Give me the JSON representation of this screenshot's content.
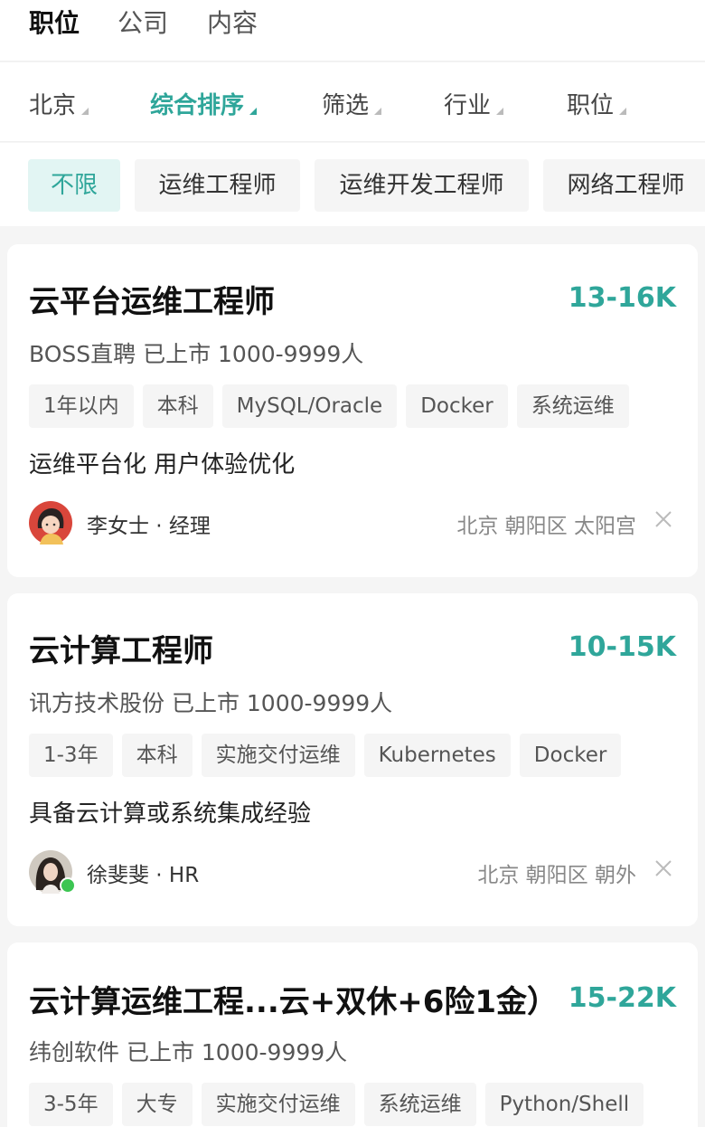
{
  "top_tabs": [
    "职位",
    "公司",
    "内容"
  ],
  "filters": {
    "city": "北京",
    "sort": "综合排序",
    "screen": "筛选",
    "industry": "行业",
    "position": "职位"
  },
  "chips": [
    "不限",
    "运维工程师",
    "运维开发工程师",
    "网络工程师"
  ],
  "colors": {
    "accent": "#2fa69a",
    "chip_active_bg": "#e2f5f3",
    "online": "#3cc552"
  },
  "jobs": [
    {
      "title": "云平台运维工程师",
      "salary": "13-16K",
      "company": "BOSS直聘 已上市 1000-9999人",
      "tags": [
        "1年以内",
        "本科",
        "MySQL/Oracle",
        "Docker",
        "系统运维"
      ],
      "desc": "运维平台化  用户体验优化",
      "recruiter": "李女士 · 经理",
      "location": "北京 朝阳区 太阳宫",
      "avatar_icon": "cartoon-woman-avatar"
    },
    {
      "title": "云计算工程师",
      "salary": "10-15K",
      "company": "讯方技术股份 已上市 1000-9999人",
      "tags": [
        "1-3年",
        "本科",
        "实施交付运维",
        "Kubernetes",
        "Docker"
      ],
      "desc": "具备云计算或系统集成经验",
      "recruiter": "徐斐斐 · HR",
      "location": "北京 朝阳区 朝外",
      "avatar_icon": "photo-avatar-online"
    },
    {
      "title": "云计算运维工程...云+双休+6险1金）",
      "salary": "15-22K",
      "company": "纬创软件 已上市 1000-9999人",
      "tags": [
        "3-5年",
        "大专",
        "实施交付运维",
        "系统运维",
        "Python/Shell"
      ]
    }
  ]
}
